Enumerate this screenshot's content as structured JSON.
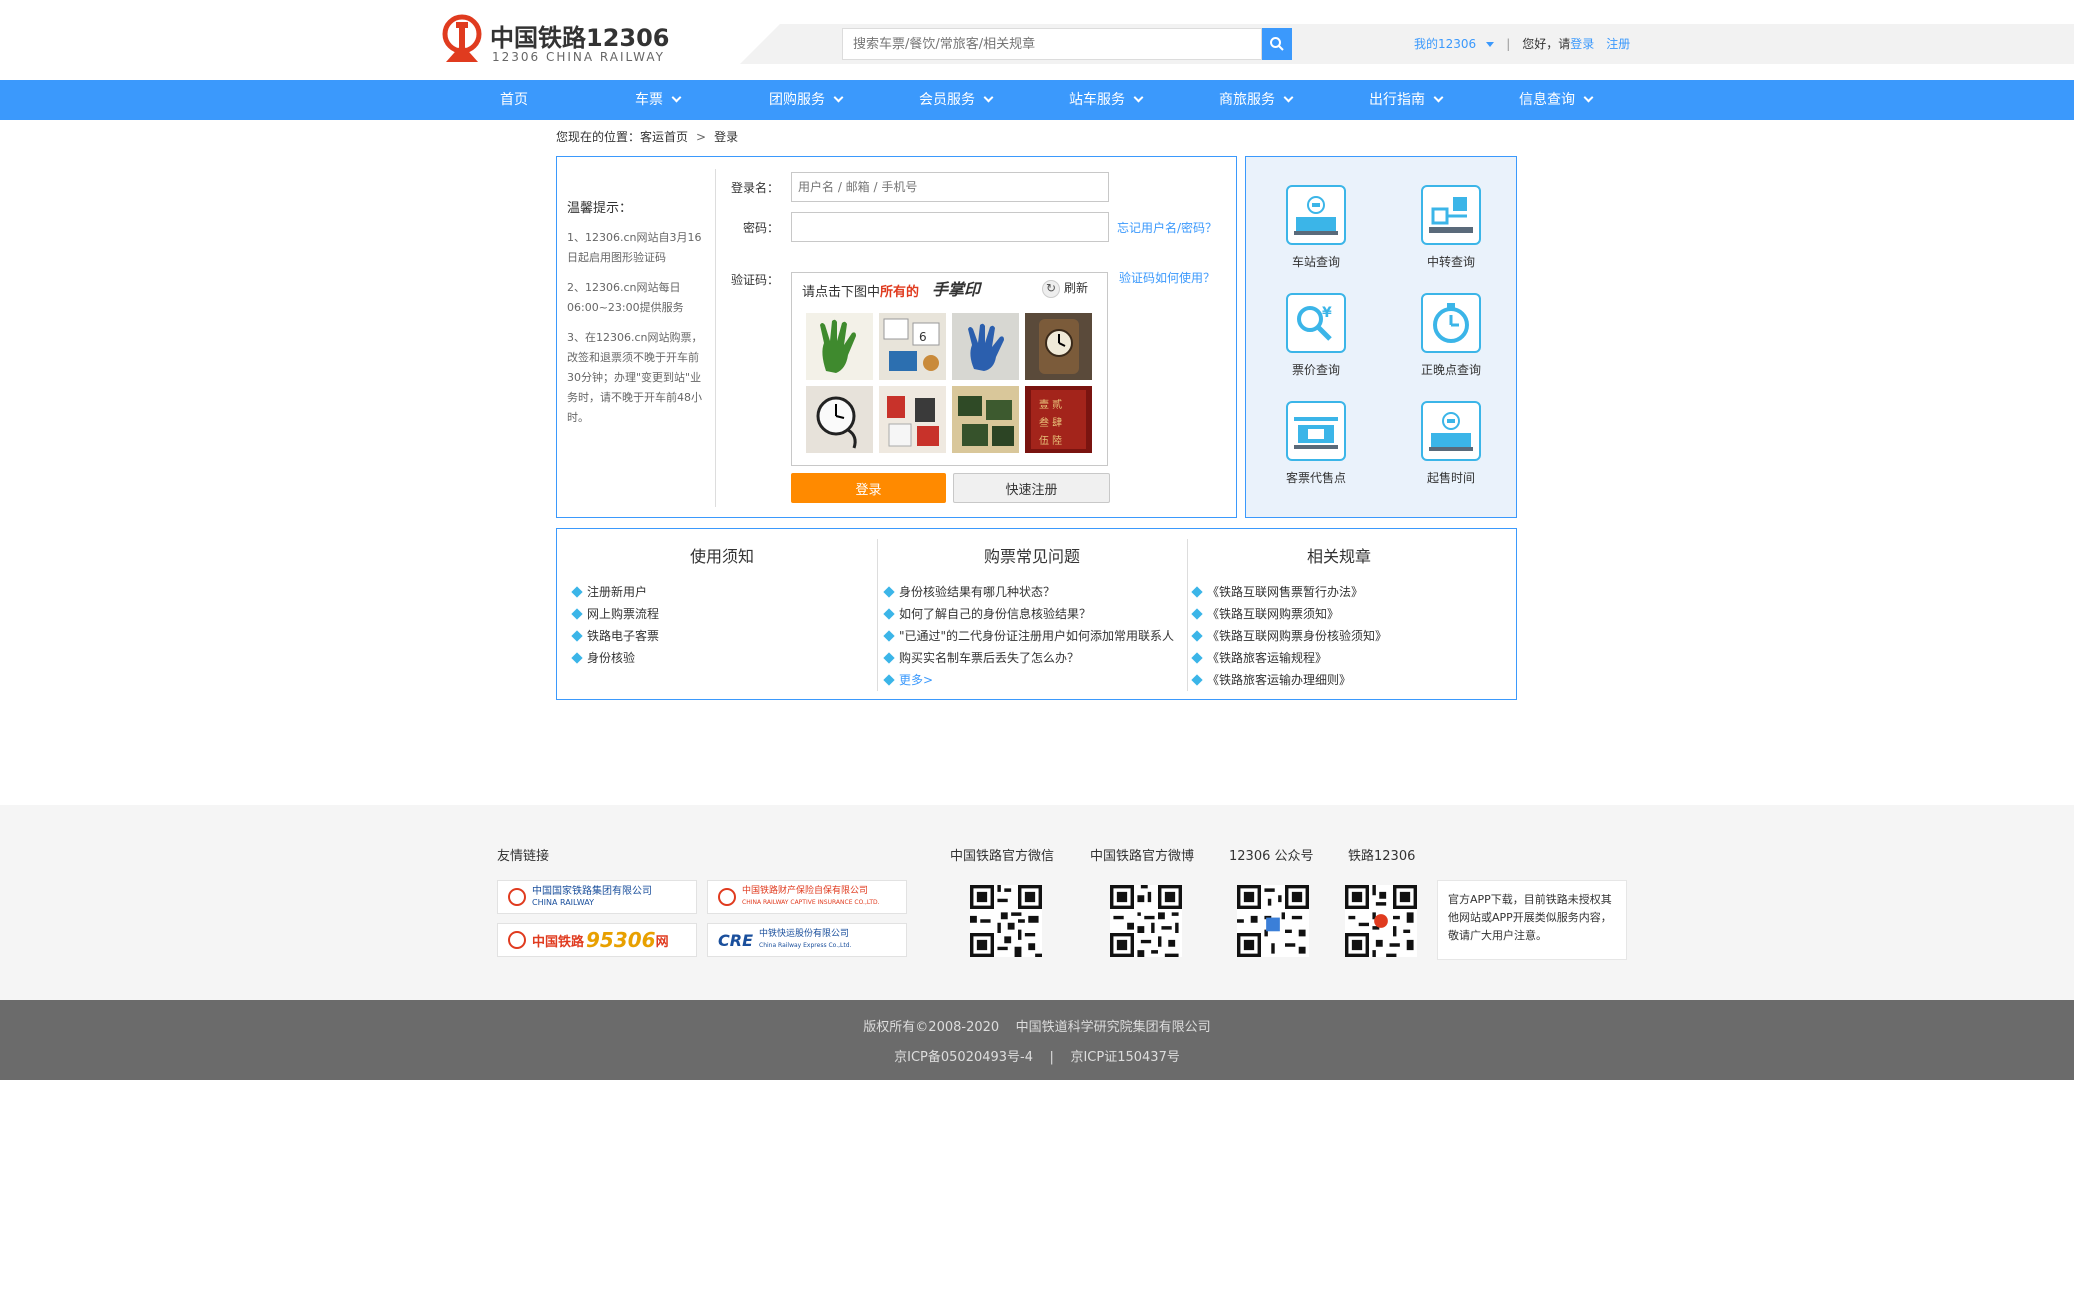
{
  "header": {
    "logo_cn": "中国铁路12306",
    "logo_en": "12306 CHINA RAILWAY",
    "search_placeholder": "搜索车票/餐饮/常旅客/相关规章",
    "my12306": "我的12306",
    "greeting": "您好，请",
    "login": "登录",
    "register": "注册"
  },
  "nav": {
    "items": [
      {
        "label": "首页"
      },
      {
        "label": "车票"
      },
      {
        "label": "团购服务"
      },
      {
        "label": "会员服务"
      },
      {
        "label": "站车服务"
      },
      {
        "label": "商旅服务"
      },
      {
        "label": "出行指南"
      },
      {
        "label": "信息查询"
      }
    ]
  },
  "breadcrumb": {
    "prefix": "您现在的位置：",
    "home": "客运首页",
    "separator": ">",
    "current": "登录"
  },
  "login": {
    "tips_title": "温馨提示：",
    "tips": [
      "1、12306.cn网站自3月16日起启用图形验证码",
      "2、12306.cn网站每日06:00~23:00提供服务",
      "3、在12306.cn网站购票，改签和退票须不晚于开车前30分钟；办理\"变更到站\"业务时，请不晚于开车前48小时。"
    ],
    "username_label": "登录名：",
    "username_placeholder": "用户名 / 邮箱 / 手机号",
    "password_label": "密码：",
    "password_value": "",
    "forgot_link": "忘记用户名/密码？",
    "captcha_label": "验证码：",
    "captcha_help_link": "验证码如何使用？",
    "captcha_prompt": "请点击下图中",
    "captcha_prompt_em": "所有的",
    "captcha_word": "手掌印",
    "captcha_refresh": "刷新",
    "login_button": "登录",
    "register_button": "快速注册"
  },
  "quick": {
    "items": [
      {
        "label": "车站查询",
        "icon": "station-icon"
      },
      {
        "label": "中转查询",
        "icon": "transfer-icon"
      },
      {
        "label": "票价查询",
        "icon": "fare-icon"
      },
      {
        "label": "正晚点查询",
        "icon": "clock-icon"
      },
      {
        "label": "客票代售点",
        "icon": "ticket-agent-icon"
      },
      {
        "label": "起售时间",
        "icon": "sale-time-icon"
      }
    ]
  },
  "info": {
    "notice_title": "使用须知",
    "notice_items": [
      "注册新用户",
      "网上购票流程",
      "铁路电子客票",
      "身份核验"
    ],
    "faq_title": "购票常见问题",
    "faq_items": [
      "身份核验结果有哪几种状态？",
      "如何了解自己的身份信息核验结果？",
      "\"已通过\"的二代身份证注册用户如何添加常用联系人",
      "购买实名制车票后丢失了怎么办？"
    ],
    "faq_more": "更多>",
    "rules_title": "相关规章",
    "rules_items": [
      "《铁路互联网售票暂行办法》",
      "《铁路互联网购票须知》",
      "《铁路互联网购票身份核验须知》",
      "《铁路旅客运输规程》",
      "《铁路旅客运输办理细则》"
    ]
  },
  "footer": {
    "friend_links_title": "友情链接",
    "partners": [
      {
        "cn": "中国国家铁路集团有限公司",
        "en": "CHINA RAILWAY"
      },
      {
        "cn": "中国铁路财产保险自保有限公司",
        "en": "CHINA RAILWAY CAPTIVE INSURANCE CO.,LTD."
      },
      {
        "cn": "中国铁路",
        "num": "95306",
        "suffix": "网"
      },
      {
        "logo": "CRE",
        "cn": "中铁快运股份有限公司",
        "en": "China Railway Express Co.,Ltd."
      }
    ],
    "qr_labels": [
      "中国铁路官方微信",
      "中国铁路官方微博",
      "12306 公众号",
      "铁路12306"
    ],
    "app_note": "官方APP下载，目前铁路未授权其他网站或APP开展类似服务内容，敬请广大用户注意。",
    "copyright_line1": "版权所有©2008-2020    中国铁道科学研究院集团有限公司",
    "copyright_line2": "京ICP备05020493号-4    |    京ICP证150437号"
  },
  "colors": {
    "brand_blue": "#3b99fc",
    "brand_red": "#e03b1f",
    "login_orange": "#ff8a00",
    "icon_teal": "#3bb5e8"
  }
}
